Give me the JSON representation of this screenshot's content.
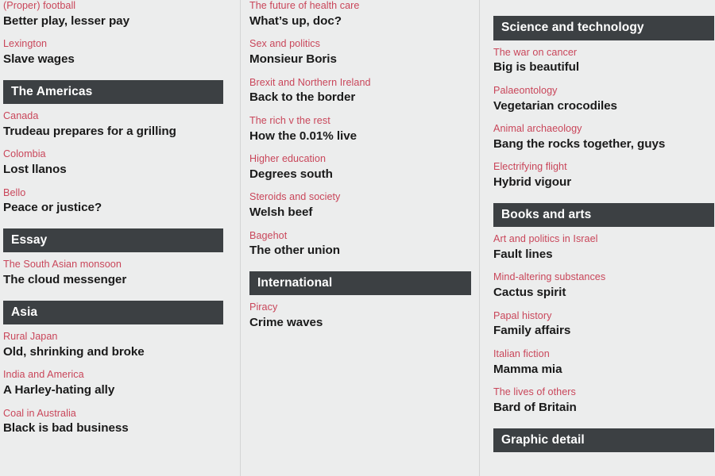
{
  "page": {
    "background_color": "#eceded",
    "header_bar_color": "#3c4043",
    "kicker_color": "#c9465a",
    "title_color": "#1a1a1a"
  },
  "columns": [
    {
      "name": "left-column",
      "sections": [
        {
          "header": null,
          "articles": [
            {
              "kicker": "(Proper) football",
              "title": "Better play, lesser pay"
            },
            {
              "kicker": "Lexington",
              "title": "Slave wages"
            }
          ]
        },
        {
          "header": "The Americas",
          "articles": [
            {
              "kicker": "Canada",
              "title": "Trudeau prepares for a grilling"
            },
            {
              "kicker": "Colombia",
              "title": "Lost llanos"
            },
            {
              "kicker": "Bello",
              "title": "Peace or justice?"
            }
          ]
        },
        {
          "header": "Essay",
          "articles": [
            {
              "kicker": "The South Asian monsoon",
              "title": "The cloud messenger"
            }
          ]
        },
        {
          "header": "Asia",
          "articles": [
            {
              "kicker": "Rural Japan",
              "title": "Old, shrinking and broke"
            },
            {
              "kicker": "India and America",
              "title": "A Harley-hating ally"
            },
            {
              "kicker": "Coal in Australia",
              "title": "Black is bad business"
            }
          ]
        }
      ]
    },
    {
      "name": "middle-column",
      "sections": [
        {
          "header": null,
          "articles": [
            {
              "kicker": "The future of health care",
              "title": "What’s up, doc?"
            },
            {
              "kicker": "Sex and politics",
              "title": "Monsieur Boris"
            },
            {
              "kicker": "Brexit and Northern Ireland",
              "title": "Back to the border"
            },
            {
              "kicker": "The rich v the rest",
              "title": "How the 0.01% live"
            },
            {
              "kicker": "Higher education",
              "title": "Degrees south"
            },
            {
              "kicker": "Steroids and society",
              "title": "Welsh beef"
            },
            {
              "kicker": "Bagehot",
              "title": "The other union"
            }
          ]
        },
        {
          "header": "International",
          "articles": [
            {
              "kicker": "Piracy",
              "title": "Crime waves"
            }
          ]
        }
      ]
    },
    {
      "name": "right-column",
      "sections": [
        {
          "header": "Science and technology",
          "articles": [
            {
              "kicker": "The war on cancer",
              "title": "Big is beautiful"
            },
            {
              "kicker": "Palaeontology",
              "title": "Vegetarian crocodiles"
            },
            {
              "kicker": "Animal archaeology",
              "title": "Bang the rocks together, guys"
            },
            {
              "kicker": "Electrifying flight",
              "title": "Hybrid vigour"
            }
          ]
        },
        {
          "header": "Books and arts",
          "articles": [
            {
              "kicker": "Art and politics in Israel",
              "title": "Fault lines"
            },
            {
              "kicker": "Mind-altering substances",
              "title": "Cactus spirit"
            },
            {
              "kicker": "Papal history",
              "title": "Family affairs"
            },
            {
              "kicker": "Italian fiction",
              "title": "Mamma mia"
            },
            {
              "kicker": "The lives of others",
              "title": "Bard of Britain"
            }
          ]
        },
        {
          "header": "Graphic detail",
          "articles": []
        }
      ]
    }
  ]
}
